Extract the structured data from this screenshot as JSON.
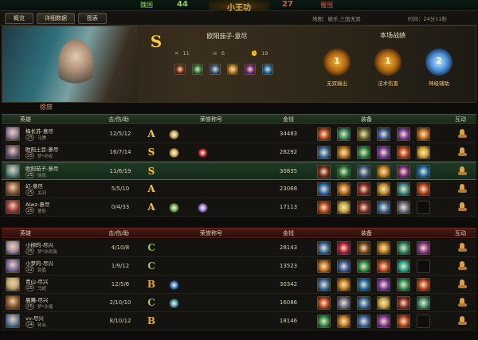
{
  "header": {
    "team_left": "魏国",
    "score_left": "44",
    "emblem_text": "小王功",
    "score_right": "27",
    "team_right": "蜀国"
  },
  "tabs": [
    "概览",
    "详细数据",
    "图表"
  ],
  "meta": {
    "map": "地图：娱乐.三国无双",
    "time": "时间：24分11秒"
  },
  "featured": {
    "grade": "S",
    "name": "欧阳茄子-意尽",
    "stats": [
      {
        "icon": "sword-icon",
        "symbol": "✕",
        "value": "11"
      },
      {
        "icon": "skull-icon",
        "symbol": "☠",
        "value": "6"
      },
      {
        "icon": "assist-icon",
        "symbol": "✊",
        "value": "19"
      }
    ],
    "items": [
      "#7a2a1a",
      "#2a7a3a",
      "#3a5a8a",
      "#c07a1a",
      "#7a2a7a",
      "#1a6aaa"
    ]
  },
  "achievements": {
    "title": "本场战绩",
    "badges": [
      {
        "rank": "1",
        "label": "无双输出",
        "style": "gold"
      },
      {
        "rank": "1",
        "label": "法术伤害",
        "style": "gold"
      },
      {
        "rank": "2",
        "label": "神级辅助",
        "style": "blue"
      }
    ]
  },
  "team_tag": "徐庶",
  "columns": {
    "hero": "英雄",
    "kda": "击/伤/助",
    "honor": "荣誉称号",
    "gold": "金钱",
    "items": "装备",
    "interact": "互动"
  },
  "team1": [
    {
      "name": "梅长苏-意尽",
      "level": "25",
      "sub": "马腾",
      "kda": "12/5/12",
      "grade": "A",
      "honors": [
        "#b89a4a"
      ],
      "gold": "34483",
      "avatar": "#8a7a9a",
      "items": [
        "#b8421a",
        "#2e8a5a",
        "#6a6a2a",
        "#3a5a9a",
        "#7a3aa0",
        "#c06a1a"
      ]
    },
    {
      "name": "欧阳土豆-意尽",
      "level": "25",
      "sub": "梦*孙权",
      "kda": "16/7/14",
      "grade": "S",
      "honors": [
        "#c9a33a",
        "#b21e1e"
      ],
      "gold": "28292",
      "avatar": "#6a5a7a",
      "items": [
        "#3a6aa0",
        "#c07a1a",
        "#2a8a4a",
        "#7a3a9a",
        "#b8421a",
        "#d0a02a"
      ]
    },
    {
      "name": "欧阳茄子-意尽",
      "level": "25",
      "sub": "徐庶",
      "kda": "11/6/19",
      "grade": "S",
      "honors": [],
      "gold": "30835",
      "avatar": "#5a8a8a",
      "items": [
        "#7a2a1a",
        "#2a7a3a",
        "#3a5a8a",
        "#c07a1a",
        "#7a2a7a",
        "#1a6aaa"
      ]
    },
    {
      "name": "幻-意尽",
      "level": "25",
      "sub": "关羽",
      "kda": "5/5/10",
      "grade": "A",
      "honors": [],
      "gold": "23068",
      "avatar": "#8a5a3a",
      "items": [
        "#2a6ab0",
        "#b86a1a",
        "#8a2a2a",
        "#c08a2a",
        "#3a8a8a",
        "#b8421a"
      ]
    },
    {
      "name": "Alwz-意尽",
      "level": "25",
      "sub": "曹彰",
      "kda": "0/4/33",
      "grade": "A",
      "honors": [
        "#6a9a3a",
        "#8a6ac0"
      ],
      "gold": "17113",
      "avatar": "#9a3a3a",
      "items": [
        "#b8421a",
        "#c0a03a",
        "#8a2a2a",
        "#3a6a9a",
        "#6a6a8a",
        ""
      ]
    }
  ],
  "team2": [
    {
      "name": "小柳的-尽兴",
      "level": "25",
      "sub": "梦*孙尚瑞",
      "kda": "4/10/8",
      "grade": "C",
      "honors": [],
      "gold": "28143",
      "avatar": "#a08aa0",
      "items": [
        "#3a6aa0",
        "#b21e3a",
        "#7a4a1a",
        "#c07a1a",
        "#2a8a6a",
        "#8a3a8a"
      ]
    },
    {
      "name": "小梦的-尽兴",
      "level": "22",
      "sub": "郭嘉",
      "kda": "1/9/12",
      "grade": "C",
      "honors": [],
      "gold": "13523",
      "avatar": "#7a6aa0",
      "items": [
        "#c06a1a",
        "#3a5a9a",
        "#2a8a4a",
        "#b8421a",
        "#1aa08a",
        ""
      ]
    },
    {
      "name": "青山-尽兴",
      "level": "25",
      "sub": "马超",
      "kda": "12/5/6",
      "grade": "B",
      "honors": [
        "#2a6ab0"
      ],
      "gold": "30342",
      "avatar": "#c0a06a",
      "items": [
        "#3a6aa0",
        "#c07a1a",
        "#1a6aaa",
        "#7a3a9a",
        "#2a8a5a",
        "#b8421a"
      ]
    },
    {
      "name": "晨曦-尽兴",
      "level": "25",
      "sub": "梦*许褚",
      "kda": "2/10/10",
      "grade": "C",
      "honors": [
        "#3a8a8a"
      ],
      "gold": "16086",
      "avatar": "#8a5a2a",
      "items": [
        "#b8421a",
        "#6a6a8a",
        "#2a6aa0",
        "#c0a03a",
        "#8a2a2a",
        "#3a8a6a"
      ]
    },
    {
      "name": "vv-尽兴",
      "level": "24",
      "sub": "钟会",
      "kda": "8/10/12",
      "grade": "B",
      "honors": [],
      "gold": "18146",
      "avatar": "#5a7aa0",
      "items": [
        "#2a8a4a",
        "#c07a1a",
        "#3a6ab0",
        "#8a3a9a",
        "#b8421a",
        ""
      ]
    }
  ],
  "colors": {
    "grade_S": "#f2c43a",
    "grade_A": "#f2c43a",
    "grade_B": "#e0a83a",
    "grade_C": "#9fc06a"
  }
}
